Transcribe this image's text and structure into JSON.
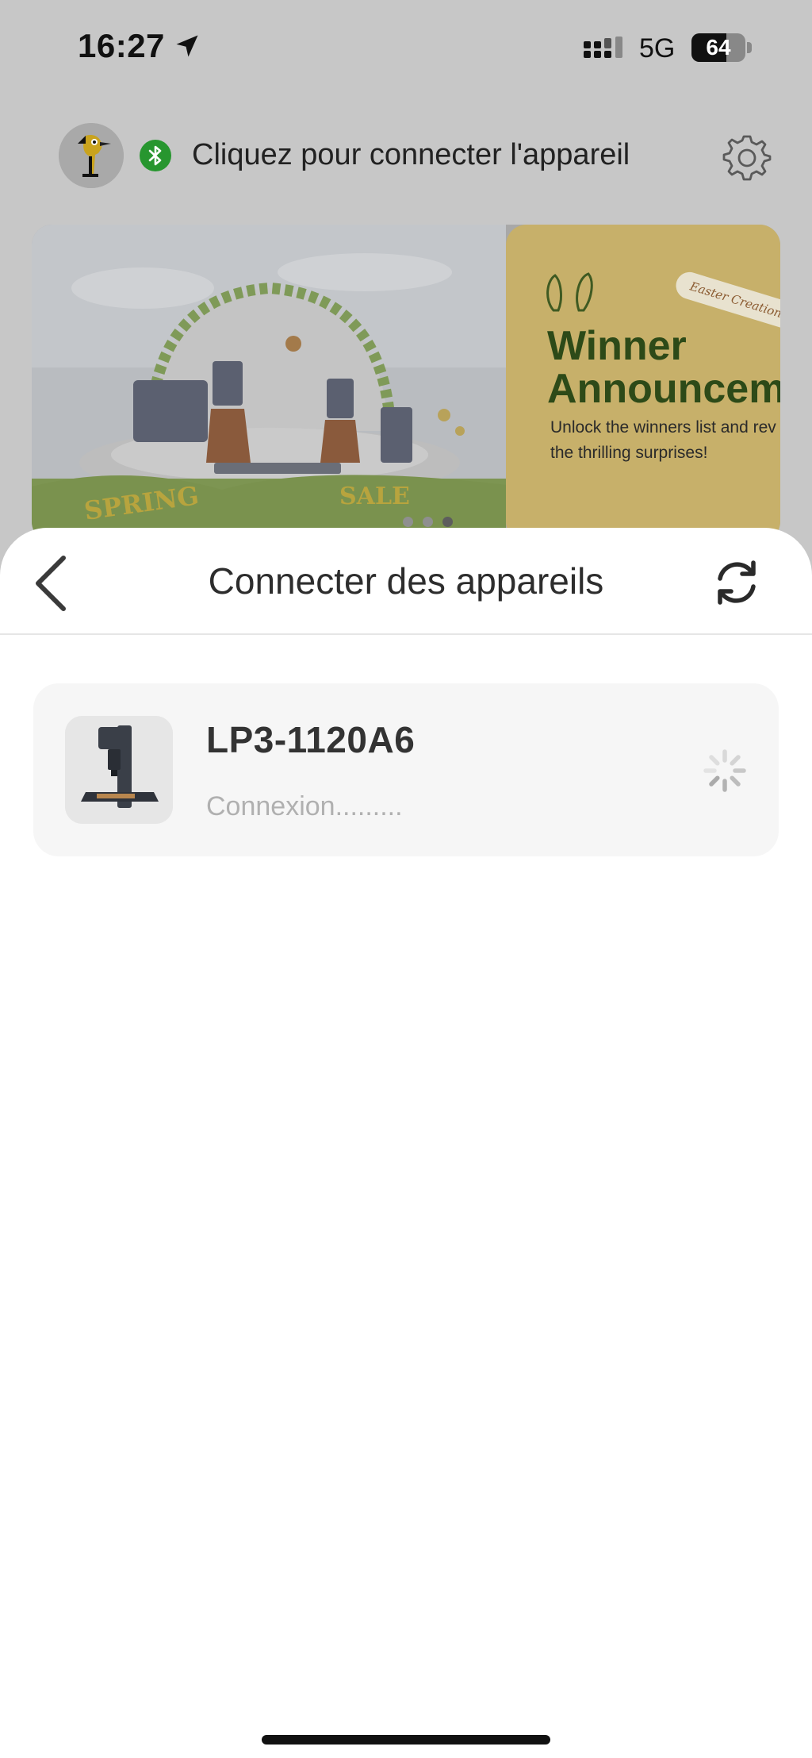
{
  "status_bar": {
    "time": "16:27",
    "network": "5G",
    "battery": "64",
    "battery_level": 0.64,
    "icons": [
      "location-arrow-icon",
      "cellular-signal-icon",
      "battery-icon"
    ]
  },
  "header": {
    "connect_prompt": "Cliquez pour connecter l'appareil",
    "icons": [
      "app-logo",
      "bluetooth-icon",
      "gear-icon"
    ],
    "bluetooth_color": "#27962f"
  },
  "banner": {
    "photo_text_left": "SPRING",
    "photo_text_right": "SALE",
    "promo_tag": "Easter Creations Contest",
    "promo_title_line1": "Winner",
    "promo_title_line2": "Announceme",
    "promo_text_line1": "Unlock the winners list and rev",
    "promo_text_line2": "the thrilling surprises!",
    "promo_color": "#c7b06a",
    "dots": 3,
    "active_dot": 2
  },
  "sheet": {
    "title": "Connecter des appareils",
    "icons": [
      "back-chevron-icon",
      "refresh-icon"
    ]
  },
  "devices": [
    {
      "name": "LP3-1120A6",
      "status": "Connexion.........",
      "icon": "loading-spinner-icon"
    }
  ]
}
